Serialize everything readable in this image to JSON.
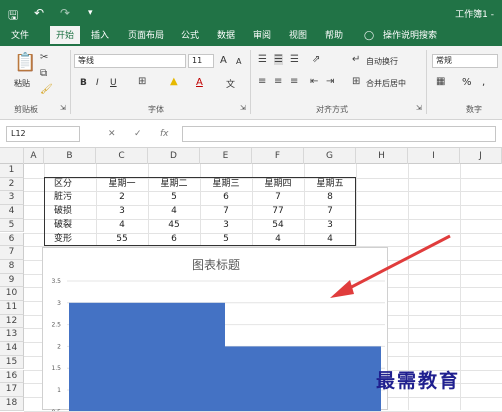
{
  "titlebar": {
    "workbook": "工作簿1 -",
    "save_icon": "save-icon",
    "undo_icon": "undo-icon",
    "redo_icon": "redo-icon"
  },
  "tabs": [
    {
      "label": "文件",
      "active": false
    },
    {
      "label": "开始",
      "active": true
    },
    {
      "label": "插入",
      "active": false
    },
    {
      "label": "页面布局",
      "active": false
    },
    {
      "label": "公式",
      "active": false
    },
    {
      "label": "数据",
      "active": false
    },
    {
      "label": "审阅",
      "active": false
    },
    {
      "label": "视图",
      "active": false
    },
    {
      "label": "帮助",
      "active": false
    },
    {
      "label": "操作说明搜索",
      "active": false
    }
  ],
  "ribbon": {
    "paste_label": "粘贴",
    "clipboard_group": "剪贴板",
    "font_name": "等线",
    "font_size": "11",
    "increase_font": "A",
    "decrease_font": "A",
    "bold": "B",
    "italic": "I",
    "underline": "U",
    "font_color_letter": "A",
    "wen": "文",
    "font_group": "字体",
    "wrap_text": "自动换行",
    "merge_center": "合并后居中",
    "alignment_group": "对齐方式",
    "number_format": "常规",
    "percent": "%",
    "comma": ",",
    "number_group": "数字"
  },
  "formula_bar": {
    "name_box": "L12",
    "fx": "fx",
    "formula": ""
  },
  "columns": [
    "A",
    "B",
    "C",
    "D",
    "E",
    "F",
    "G",
    "H",
    "I",
    "J"
  ],
  "rows": [
    "1",
    "2",
    "3",
    "4",
    "5",
    "6",
    "7",
    "8",
    "9",
    "10",
    "11",
    "12",
    "13",
    "14",
    "15",
    "16",
    "17",
    "18"
  ],
  "table": {
    "header": [
      "区分",
      "星期一",
      "星期二",
      "星期三",
      "星期四",
      "星期五"
    ],
    "rows": [
      [
        "脏污",
        "2",
        "5",
        "6",
        "7",
        "8"
      ],
      [
        "破损",
        "3",
        "4",
        "7",
        "77",
        "7"
      ],
      [
        "破裂",
        "4",
        "45",
        "3",
        "54",
        "3"
      ],
      [
        "变形",
        "55",
        "6",
        "5",
        "4",
        "4"
      ]
    ]
  },
  "chart_data": {
    "type": "bar",
    "title": "图表标题",
    "yticks": [
      "3.5",
      "3",
      "2.5",
      "2",
      "1.5",
      "1",
      "0.5"
    ],
    "ylim": [
      0,
      3.5
    ],
    "values": [
      3,
      2
    ],
    "bar_color": "#4472c4"
  },
  "annotation": {
    "arrow_color": "#e03c3c"
  },
  "watermark": "最需教育",
  "colors": {
    "excel_green": "#217346",
    "ribbon_bg": "#f3f3f3",
    "header_bg": "#f2f2f2"
  }
}
